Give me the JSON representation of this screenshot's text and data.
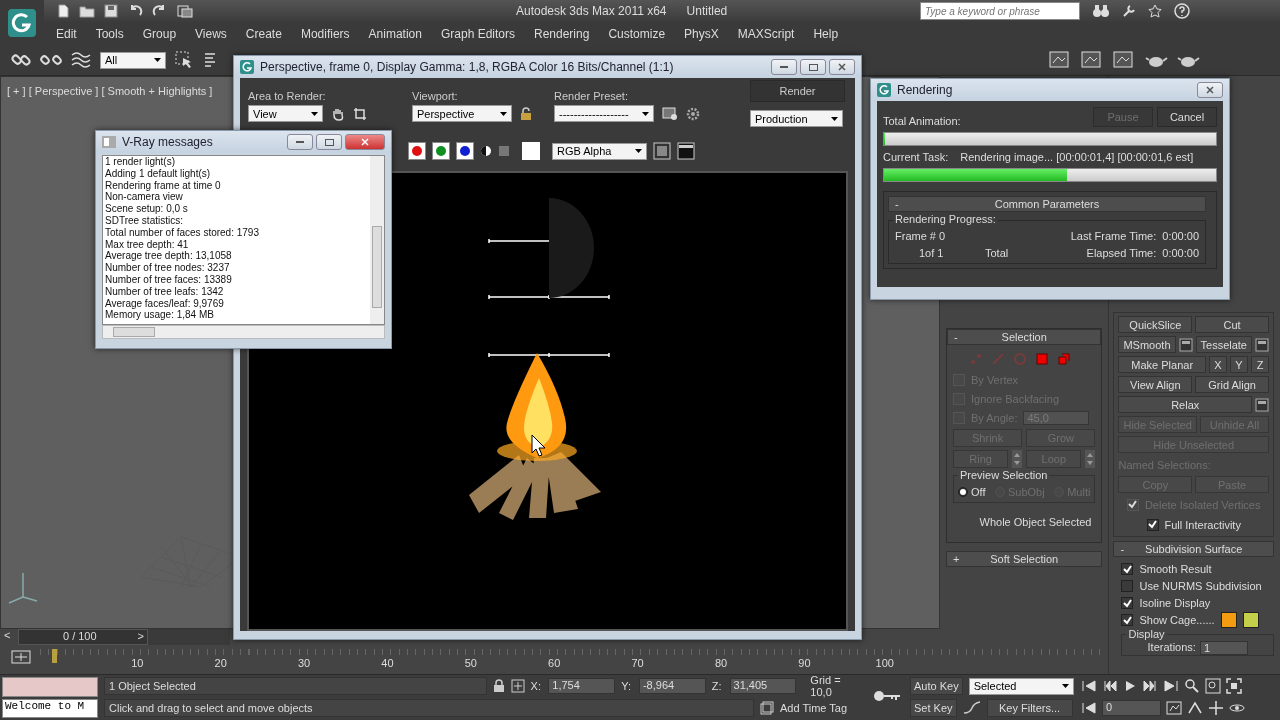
{
  "app_title": {
    "app": "Autodesk 3ds Max  2011 x64",
    "document": "Untitled"
  },
  "search": {
    "placeholder": "Type a keyword or phrase"
  },
  "menu": [
    "Edit",
    "Tools",
    "Group",
    "Views",
    "Create",
    "Modifiers",
    "Animation",
    "Graph Editors",
    "Rendering",
    "Customize",
    "PhysX",
    "MAXScript",
    "Help"
  ],
  "toolbar": {
    "selection_filter": "All"
  },
  "viewport": {
    "label": "[ + ] [ Perspective ] [ Smooth + Highlights ]"
  },
  "vray_messages": {
    "title": "V-Ray messages",
    "lines": [
      "1 render light(s)",
      "Adding 1 default light(s)",
      "Rendering frame at time 0",
      "Non-camera view",
      "Scene setup: 0,0 s",
      "SDTree statistics:",
      "Total number of faces stored: 1793",
      "Max tree depth: 41",
      "Average tree depth: 13,1058",
      "Number of tree nodes: 3237",
      "Number of tree faces: 13389",
      "Number of tree leafs: 1342",
      "Average faces/leaf: 9,9769",
      "Memory usage: 1,84 MB"
    ]
  },
  "render_window": {
    "title": "Perspective, frame 0, Display Gamma: 1,8, RGBA Color 16 Bits/Channel (1:1)",
    "area_label": "Area to Render:",
    "area_value": "View",
    "viewport_label": "Viewport:",
    "viewport_value": "Perspective",
    "preset_label": "Render Preset:",
    "preset_value": "-------------------",
    "render_button": "Render",
    "mode_value": "Production",
    "channel_value": "RGB Alpha",
    "channels": [
      {
        "color": "#e01010"
      },
      {
        "color": "#109020"
      },
      {
        "color": "#1020d0"
      }
    ]
  },
  "rendering_dialog": {
    "title": "Rendering",
    "pause": {
      "label": "Pause",
      "disabled": true
    },
    "cancel": {
      "label": "Cancel",
      "disabled": false
    },
    "total_label": "Total Animation:",
    "total_progress": {
      "level": 0
    },
    "task_label": "Current Task:",
    "task_text": "Rendering image... [00:00:01,4] [00:00:01,6 est]",
    "task_progress": {
      "level": 0.55
    },
    "rollout_sign": "-",
    "rollout_title": "Common Parameters",
    "group_title": "Rendering Progress:",
    "frame_label": "Frame #",
    "frame_value": "0",
    "frame_count": "1of 1",
    "total_text": "Total",
    "last_frame_label": "Last Frame Time:",
    "last_frame_value": "0:00:00",
    "elapsed_label": "Elapsed Time:",
    "elapsed_value": "0:00:00"
  },
  "selection": {
    "sign": "-",
    "title": "Selection",
    "options": [
      {
        "label": "By Vertex",
        "checked": false,
        "disabled": true
      },
      {
        "label": "Ignore Backfacing",
        "checked": false,
        "disabled": true
      },
      {
        "label": "By Angle:",
        "checked": false,
        "disabled": true,
        "value": "45,0"
      }
    ],
    "buttons": [
      {
        "label": "Shrink",
        "disabled": true
      },
      {
        "label": "Grow",
        "disabled": true
      }
    ],
    "spin_buttons": [
      {
        "label": "Ring",
        "disabled": true
      },
      {
        "label": "Loop",
        "disabled": true
      }
    ],
    "preview_title": "Preview Selection",
    "preview": [
      {
        "label": "Off",
        "selected": true,
        "disabled": false
      },
      {
        "label": "SubObj",
        "selected": false,
        "disabled": true
      },
      {
        "label": "Multi",
        "selected": false,
        "disabled": true
      }
    ],
    "status": "Whole Object Selected"
  },
  "soft_selection": {
    "sign": "+",
    "title": "Soft Selection"
  },
  "edit_geometry": [
    [
      {
        "kind": "button",
        "label": "QuickSlice",
        "disabled": false
      },
      {
        "kind": "button",
        "label": "Cut",
        "disabled": false
      }
    ],
    [
      {
        "kind": "button",
        "label": "MSmooth",
        "disabled": false
      },
      {
        "kind": "settings",
        "disabled": false
      },
      {
        "kind": "button",
        "label": "Tesselate",
        "disabled": false
      },
      {
        "kind": "settings",
        "disabled": false
      }
    ],
    [
      {
        "kind": "button",
        "label": "Make Planar",
        "disabled": false
      },
      {
        "kind": "button",
        "label": "X",
        "disabled": false
      },
      {
        "kind": "button",
        "label": "Y",
        "disabled": false
      },
      {
        "kind": "button",
        "label": "Z",
        "disabled": false
      }
    ],
    [
      {
        "kind": "button",
        "label": "View Align",
        "disabled": false
      },
      {
        "kind": "button",
        "label": "Grid Align",
        "disabled": false
      }
    ],
    [
      {
        "kind": "button",
        "label": "Relax",
        "disabled": false
      },
      {
        "kind": "settings",
        "disabled": false
      }
    ],
    [
      {
        "kind": "button",
        "label": "Hide Selected",
        "disabled": true
      },
      {
        "kind": "button",
        "label": "Unhide All",
        "disabled": true
      }
    ],
    [
      {
        "kind": "button",
        "label": "Hide Unselected",
        "disabled": true
      }
    ],
    [
      {
        "kind": "label",
        "label": "Named Selections:",
        "disabled": true
      }
    ],
    [
      {
        "kind": "button",
        "label": "Copy",
        "disabled": true
      },
      {
        "kind": "button",
        "label": "Paste",
        "disabled": true
      }
    ],
    [
      {
        "kind": "checkbox",
        "label": "Delete Isolated Vertices",
        "checked": true,
        "disabled": true
      }
    ],
    [
      {
        "kind": "checkbox",
        "label": "Full Interactivity",
        "checked": true,
        "disabled": false
      }
    ]
  ],
  "subdivision": {
    "sign": "-",
    "title": "Subdivision Surface",
    "options": [
      {
        "label": "Smooth Result",
        "checked": true
      },
      {
        "label": "Use NURMS Subdivision",
        "checked": false
      },
      {
        "label": "Isoline Display",
        "checked": true
      },
      {
        "label": "Show Cage......",
        "checked": true
      }
    ],
    "cage_colors": [
      {
        "color": "#f39c12"
      },
      {
        "color": "#c5d04a"
      }
    ],
    "display_title": "Display",
    "iterations_label": "Iterations:",
    "iterations_value": "1"
  },
  "timeline": {
    "slider": "0 / 100",
    "level": 0,
    "prev": "<",
    "next": ">",
    "ticks": [
      "10",
      "20",
      "30",
      "40",
      "50",
      "60",
      "70",
      "80",
      "90",
      "100"
    ]
  },
  "status_bar": {
    "listener": "Welcome to M",
    "selected": "1 Object Selected",
    "prompt": "Click and drag to select and move objects",
    "coords": [
      {
        "label": "X:",
        "value": "1,754"
      },
      {
        "label": "Y:",
        "value": "-8,964"
      },
      {
        "label": "Z:",
        "value": "31,405"
      }
    ],
    "grid": "Grid = 10,0",
    "time_tag": "Add Time Tag",
    "auto_key": "Auto Key",
    "key_mode": "Selected",
    "set_key": "Set Key",
    "key_filters": "Key Filters...",
    "frame": "0"
  }
}
